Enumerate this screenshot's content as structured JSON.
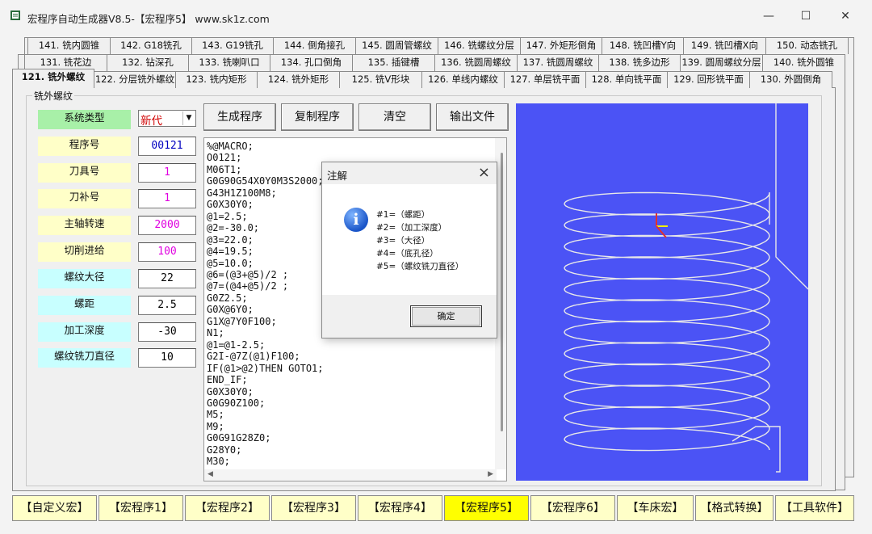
{
  "window": {
    "title": "宏程序自动生成器V8.5-【宏程序5】   www.sk1z.com",
    "controls": {
      "minimize": "—",
      "maximize": "☐",
      "close": "✕"
    }
  },
  "tabs": {
    "row1": [
      "141. 铣内圆锥",
      "142. G18铣孔",
      "143. G19铣孔",
      "144. 倒角接孔",
      "145. 圆周管螺纹",
      "146. 铣螺纹分层",
      "147. 外矩形倒角",
      "148. 铣凹槽Y向",
      "149. 铣凹槽X向",
      "150. 动态铣孔"
    ],
    "row2": [
      "131. 铣花边",
      "132. 钻深孔",
      "133. 铣喇叭口",
      "134. 孔口倒角",
      "135. 插键槽",
      "136. 铣圆周螺纹",
      "137. 铣圆周螺纹",
      "138. 铣多边形",
      "139. 圆周螺纹分层",
      "140. 铣外圆锥"
    ],
    "row3": [
      "121. 铣外螺纹",
      "122. 分层铣外螺纹",
      "123. 铣内矩形",
      "124. 铣外矩形",
      "125. 铣V形块",
      "126. 单线内螺纹",
      "127. 单层铣平面",
      "128. 单向铣平面",
      "129. 回形铣平面",
      "130. 外圆倒角"
    ],
    "active": "121. 铣外螺纹"
  },
  "group_title": "铣外螺纹",
  "params": [
    {
      "label": "系统类型",
      "value": "新代",
      "color": "#a8f0a8"
    },
    {
      "label": "程序号",
      "value": "00121",
      "color": "#ffffc8"
    },
    {
      "label": "刀具号",
      "value": "1",
      "color": "#ffffc8"
    },
    {
      "label": "刀补号",
      "value": "1",
      "color": "#ffffc8"
    },
    {
      "label": "主轴转速",
      "value": "2000",
      "color": "#ffffc8"
    },
    {
      "label": "切削进给",
      "value": "100",
      "color": "#ffffc8"
    },
    {
      "label": "螺纹大径",
      "value": "22",
      "color": "#c8ffff"
    },
    {
      "label": "螺距",
      "value": "2.5",
      "color": "#c8ffff"
    },
    {
      "label": "加工深度",
      "value": "-30",
      "color": "#c8ffff"
    },
    {
      "label": "螺纹铣刀直径",
      "value": "10",
      "color": "#c8ffff"
    }
  ],
  "value_colors": [
    "#d00000",
    "#0000c0",
    "#e000e0",
    "#e000e0",
    "#e000e0",
    "#e000e0",
    "#000000",
    "#000000",
    "#000000",
    "#000000"
  ],
  "actions": {
    "generate": "生成程序",
    "copy": "复制程序",
    "clear": "清空",
    "export": "输出文件"
  },
  "code_lines": [
    "%@MACRO;",
    "O0121;",
    "M06T1;",
    "G0G90G54X0Y0M3S2000;",
    "G43H1Z100M8;",
    "G0X30Y0;",
    "@1=2.5;",
    "@2=-30.0;",
    "@3=22.0;",
    "@4=19.5;",
    "@5=10.0;",
    "@6=(@3+@5)/2 ;",
    "@7=(@4+@5)/2 ;",
    "G0Z2.5;",
    "G0X@6Y0;",
    "G1X@7Y0F100;",
    "N1;",
    "@1=@1-2.5;",
    "G2I-@7Z(@1)F100;",
    "IF(@1>@2)THEN GOTO1;",
    "END_IF;",
    "G0X30Y0;",
    "G0G90Z100;",
    "M5;",
    "M9;",
    "G0G91G28Z0;",
    "G28Y0;",
    "M30;"
  ],
  "dialog": {
    "title": "注解",
    "lines": [
      "#1=（螺距）",
      "#2=（加工深度）",
      "#3=（大径）",
      "#4=（底孔径）",
      "#5=（螺纹铣刀直径）"
    ],
    "ok": "确定",
    "icon": "info-icon"
  },
  "viewport": {
    "background": "#4b53f5",
    "helix_turns": 12
  },
  "bottom_nav": [
    "【自定义宏】",
    "【宏程序1】",
    "【宏程序2】",
    "【宏程序3】",
    "【宏程序4】",
    "【宏程序5】",
    "【宏程序6】",
    "【车床宏】",
    "【格式转换】",
    "【工具软件】"
  ],
  "bottom_active": "【宏程序5】"
}
